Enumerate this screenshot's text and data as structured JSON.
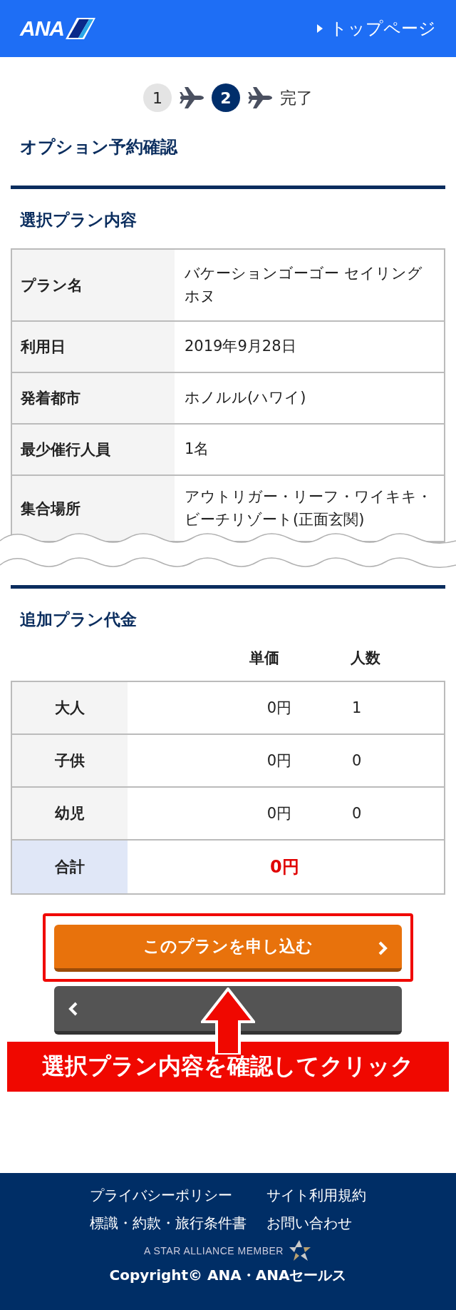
{
  "header": {
    "logo": "ANA",
    "link": "トップページ"
  },
  "steps": [
    {
      "kind": "number",
      "label": "1",
      "selected": false
    },
    {
      "kind": "number",
      "label": "2",
      "selected": true
    },
    {
      "kind": "text",
      "label": "完了",
      "selected": false
    }
  ],
  "page_title": "オプション予約確認",
  "plan": {
    "heading": "選択プラン内容",
    "rows": [
      {
        "label": "プラン名",
        "value": "バケーションゴーゴー セイリングホヌ"
      },
      {
        "label": "利用日",
        "value": "2019年9月28日"
      },
      {
        "label": "発着都市",
        "value": "ホノルル(ハワイ)"
      },
      {
        "label": "最少催行人員",
        "value": "1名"
      },
      {
        "label": "集合場所",
        "value": "アウトリガー・リーフ・ワイキキ・ビーチリゾート(正面玄関)"
      }
    ]
  },
  "price": {
    "heading": "追加プラン代金",
    "columns": [
      "単価",
      "人数"
    ],
    "rows": [
      {
        "kind": "line",
        "label": "大人",
        "unit_price": "0円",
        "count": "1"
      },
      {
        "kind": "line",
        "label": "子供",
        "unit_price": "0円",
        "count": "0"
      },
      {
        "kind": "line",
        "label": "幼児",
        "unit_price": "0円",
        "count": "0"
      },
      {
        "kind": "total",
        "label": "合計",
        "total": "0円"
      }
    ]
  },
  "apply_button": "このプランを申し込む",
  "annotation": "選択プラン内容を確認してクリック",
  "footer": {
    "links": [
      "プライバシーポリシー",
      "サイト利用規約",
      "標識・約款・旅行条件書",
      "お問い合わせ"
    ],
    "alliance": "A STAR ALLIANCE MEMBER",
    "copyright": "Copyright© ANA・ANAセールス"
  }
}
